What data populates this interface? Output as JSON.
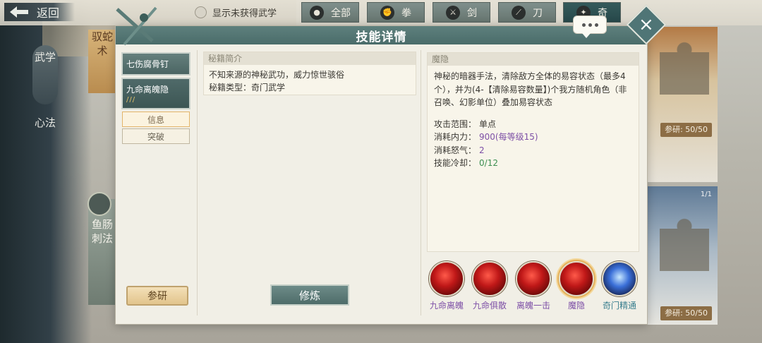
{
  "top": {
    "back_label": "返回",
    "show_unobtained_label": "显示未获得武学",
    "filter_tabs": [
      {
        "label": "全部",
        "icon": "bag-icon"
      },
      {
        "label": "拳",
        "icon": "fist-icon"
      },
      {
        "label": "剑",
        "icon": "sword-icon"
      },
      {
        "label": "刀",
        "icon": "blade-icon"
      },
      {
        "label": "奇",
        "icon": "exotic-icon",
        "active": true
      }
    ]
  },
  "left_tabs": {
    "wuxue": "武学",
    "xinfa": "心法"
  },
  "bg_cards": {
    "left_top_text": "驭蛇术",
    "left_bottom_text": "鱼肠刺法",
    "right_top_research": "参研: 50/50",
    "right_bottom_research": "参研: 50/50",
    "right_bottom_count": "1/1"
  },
  "modal": {
    "title": "技能详情",
    "skills": [
      {
        "name": "七伤腐骨钉",
        "marks": ""
      },
      {
        "name": "九命离魄隐",
        "marks": "///"
      }
    ],
    "sub_buttons": [
      "信息",
      "突破"
    ],
    "research_label": "参研",
    "practice_label": "修炼",
    "intro": {
      "header": "秘籍简介",
      "line1": "不知来源的神秘武功，威力惊世骇俗",
      "type_label": "秘籍类型：",
      "type_value": "奇门武学"
    },
    "detail": {
      "header": "魔隐",
      "desc": "神秘的暗器手法，清除敌方全体的易容状态（最多4个），并为(4-【清除易容数量】)个我方随机角色（非召唤、幻影单位）叠加易容状态",
      "stats": [
        {
          "label": "攻击范围：",
          "value": "单点",
          "style": "plain"
        },
        {
          "label": "消耗内力：",
          "value": "900(每等级15)",
          "style": "purple"
        },
        {
          "label": "消耗怒气：",
          "value": "2",
          "style": "purple"
        },
        {
          "label": "技能冷却：",
          "value": "0/12",
          "style": "green"
        }
      ]
    },
    "skill_icons": [
      {
        "label": "九命离魄",
        "icon": "red-demon-icon"
      },
      {
        "label": "九命俱散",
        "icon": "red-skull-icon"
      },
      {
        "label": "离魄一击",
        "icon": "red-strike-icon"
      },
      {
        "label": "魔隐",
        "icon": "red-vortex-icon",
        "selected": true
      },
      {
        "label": "奇门精通",
        "icon": "blue-figure-icon"
      }
    ]
  },
  "colors": {
    "header_teal": "#4a6c6a",
    "purple_text": "#7d4fa6",
    "green_text": "#3d8f52",
    "accent_gold": "#e5b15b"
  }
}
